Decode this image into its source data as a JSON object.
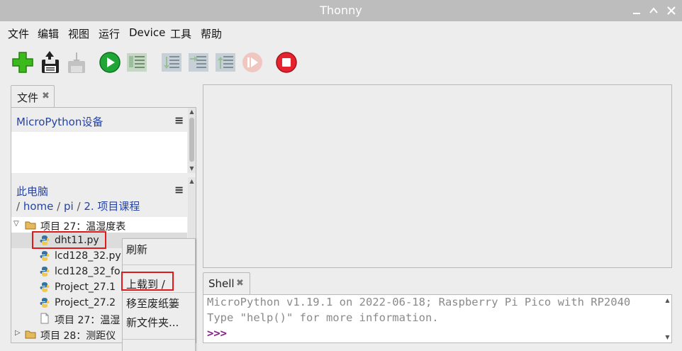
{
  "window": {
    "title": "Thonny"
  },
  "menubar": [
    "文件",
    "编辑",
    "视图",
    "运行",
    "Device",
    "工具",
    "帮助"
  ],
  "toolbar": [
    {
      "name": "new-file",
      "icon": "green-plus-icon",
      "enabled": true
    },
    {
      "name": "save",
      "icon": "floppy-disk-icon",
      "enabled": true
    },
    {
      "name": "save-disabled",
      "icon": "download-icon",
      "enabled": false
    },
    {
      "name": "run",
      "icon": "green-play-icon",
      "enabled": true
    },
    {
      "name": "debug",
      "icon": "debug-icon",
      "enabled": false
    },
    {
      "name": "step-over",
      "icon": "step-over-icon",
      "enabled": false
    },
    {
      "name": "step-into",
      "icon": "step-into-icon",
      "enabled": false
    },
    {
      "name": "step-out",
      "icon": "step-out-icon",
      "enabled": false
    },
    {
      "name": "resume",
      "icon": "resume-icon",
      "enabled": false
    },
    {
      "name": "stop",
      "icon": "red-stop-icon",
      "enabled": true
    }
  ],
  "files_panel": {
    "tab_label": "文件",
    "device_title": "MicroPython设备",
    "pc_title": "此电脑",
    "breadcrumb": {
      "sep": "/",
      "home": "home",
      "pi": "pi",
      "folder": "2. 项目课程"
    },
    "tree": [
      {
        "label": "项目 27：温湿度表",
        "type": "folder",
        "expanded": true
      },
      {
        "label": "dht11.py",
        "type": "python"
      },
      {
        "label": "lcd128_32.py",
        "type": "python"
      },
      {
        "label": "lcd128_32_fo",
        "type": "python"
      },
      {
        "label": "Project_27.1",
        "type": "python"
      },
      {
        "label": "Project_27.2",
        "type": "python"
      },
      {
        "label": "项目 27：温湿",
        "type": "file"
      },
      {
        "label": "项目 28：测距仪",
        "type": "folder",
        "expanded": false
      }
    ]
  },
  "context_menu": {
    "items": [
      "刷新",
      "上载到 /",
      "移至废纸篓",
      "新文件夹..."
    ]
  },
  "shell": {
    "tab_label": "Shell",
    "lines": [
      "MicroPython v1.19.1 on 2022-06-18; Raspberry Pi Pico with RP2040",
      "Type \"help()\" for more information."
    ],
    "prompt": ">>>"
  },
  "colors": {
    "accent_link": "#2543a7",
    "highlight_box": "#e2191b",
    "prompt": "#8b1e8b",
    "titlebar": "#bdbdbd"
  }
}
